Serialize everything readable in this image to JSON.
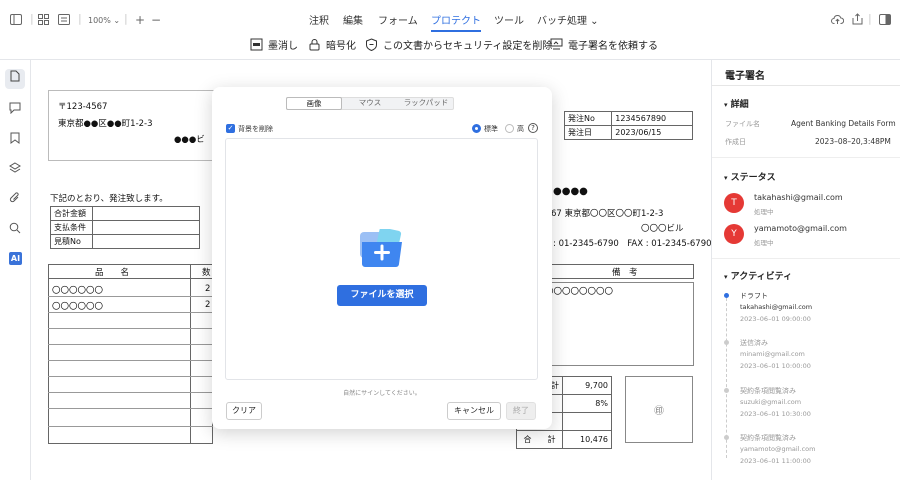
{
  "toolbar": {
    "zoom": "100%",
    "plus": "+",
    "minus": "−",
    "menus": [
      "注釈",
      "編集",
      "フォーム",
      "プロテクト",
      "ツール",
      "バッチ処理"
    ],
    "sub": [
      "墨消し",
      "暗号化",
      "この文書からセキュリティ設定を削除",
      "電子署名を依頼する"
    ]
  },
  "rail": {
    "ai": "AI"
  },
  "document": {
    "postal": "〒123-4567",
    "address": "東京都●●区●●町1-2-3",
    "company_partial": "●●●ビ",
    "order_no_label": "発注No",
    "order_no": "1234567890",
    "order_date_label": "発注日",
    "order_date": "2023/06/15",
    "intro": "下記のとおり、発注致します。",
    "summary_labels": [
      "合計金額",
      "支払条件",
      "見積No"
    ],
    "vendor_name": "●●●●",
    "vendor_address": "67 東京都〇〇区〇〇町1-2-3",
    "vendor_building": "〇〇〇ビル",
    "vendor_phone": ": 01-2345-6790　FAX : 01-2345-6790",
    "item_header": "品　　名",
    "qty_header_partial": "数",
    "remarks_header": "備　考",
    "items": [
      "〇〇〇〇〇〇",
      "〇〇〇〇〇〇"
    ],
    "item_qty_partial": [
      "2",
      "2"
    ],
    "remarks_value": "〇〇〇〇〇〇〇〇",
    "subtotal_label_partial": "計",
    "subtotal": "9,700",
    "tax_rate": "8%",
    "total_label": "合　　計",
    "total": "10,476",
    "seal": "㊞"
  },
  "dialog": {
    "tabs": [
      "画像",
      "マウス",
      "ラックパッド"
    ],
    "remove_bg": "背景を削除",
    "standard": "標準",
    "high": "高",
    "help": "?",
    "choose_file": "ファイルを選択",
    "sign_hint": "自然にサインしてください。",
    "clear": "クリア",
    "cancel": "キャンセル",
    "done": "終了"
  },
  "panel": {
    "title": "電子署名",
    "details": "詳細",
    "file_name_label": "ファイル名",
    "file_name": "Agent Banking Details Form",
    "created_label": "作成日",
    "created": "2023–08–20,3:48PM",
    "status": "ステータス",
    "signers": [
      {
        "initial": "T",
        "email": "takahashi@gmail.com",
        "state": "処理中"
      },
      {
        "initial": "Y",
        "email": "yamamoto@gmail.com",
        "state": "処理中"
      }
    ],
    "activity": "アクティビティ",
    "events": [
      {
        "title": "ドラフト",
        "email": "takahashi@gmail.com",
        "time": "2023–06–01 09:00:00"
      },
      {
        "title": "送信済み",
        "email": "minami@gmail.com",
        "time": "2023–06–01 10:00:00"
      },
      {
        "title": "契約条項閲覧済み",
        "email": "suzuki@gmail.com",
        "time": "2023–06–01 10:30:00"
      },
      {
        "title": "契約条項閲覧済み",
        "email": "yamamoto@gmail.com",
        "time": "2023–06–01 11:00:00"
      }
    ]
  },
  "colors": {
    "accent": "#2f6fe0",
    "avatar": "#e53935"
  }
}
